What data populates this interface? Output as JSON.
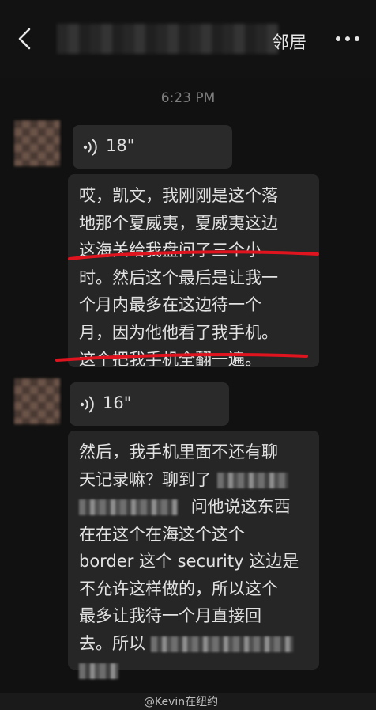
{
  "header": {
    "title_visible_fragment": "邻居",
    "back_icon": "chevron-left-icon",
    "more_icon": "more-dots-icon"
  },
  "timestamp": "6:23 PM",
  "messages": [
    {
      "voice_duration": "18\"",
      "transcript_lines": [
        "哎，凯文，我刚刚是这个落",
        "地那个夏威夷，夏威夷这边",
        "这海关给我盘问了三个小",
        "时。然后这个最后是让我一",
        "个月内最多在这边待一个",
        "月，因为他他看了我手机。",
        "这个把我手机全翻一遍。"
      ]
    },
    {
      "voice_duration": "16\"",
      "transcript_lines": {
        "l1": "然后，我手机里面不还有聊",
        "l2": "天记录嘛？聊到了",
        "l3": "问他说这东西",
        "l4": "在在这个在海这个这个",
        "l5": "border 这个 security 这边是",
        "l6": "不允许这样做的，所以这个",
        "l7": "最多让我待一个月直接回",
        "l8": "去。所以"
      }
    }
  ],
  "watermark": "@Kevin在纽约",
  "colors": {
    "background": "#111111",
    "bubble": "#2a2a2a",
    "annotation": "#e0141e"
  }
}
